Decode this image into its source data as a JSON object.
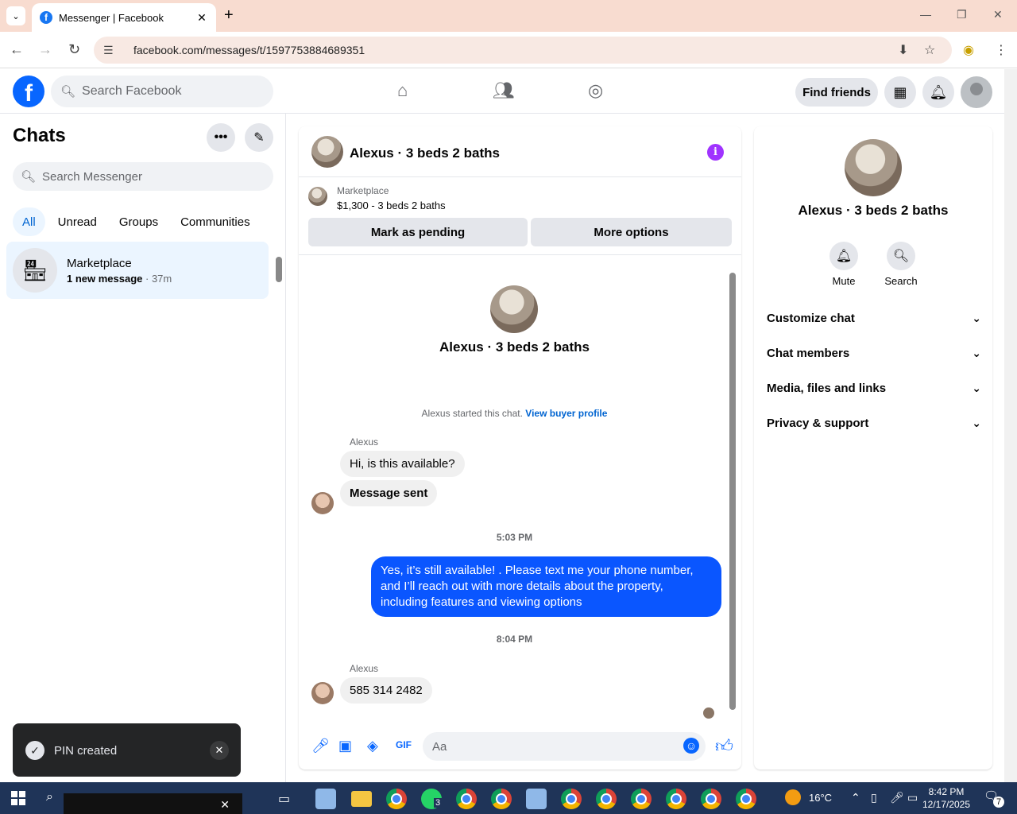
{
  "browser": {
    "tab_title": "Messenger | Facebook",
    "url": "facebook.com/messages/t/1597753884689351"
  },
  "header": {
    "search_placeholder": "Search Facebook",
    "find_friends": "Find friends"
  },
  "left": {
    "title": "Chats",
    "search_placeholder": "Search Messenger",
    "filters": [
      "All",
      "Unread",
      "Groups",
      "Communities"
    ],
    "chat": {
      "name": "Marketplace",
      "subtitle_bold": "1 new message",
      "time": "37m"
    }
  },
  "conversation": {
    "title": "Alexus · 3 beds 2 baths",
    "listing_source": "Marketplace",
    "listing_price": "$1,300 - 3 beds 2 baths",
    "mark_pending": "Mark as pending",
    "more_options": "More options",
    "profile_name": "Alexus · 3 beds 2 baths",
    "started_text": "Alexus started this chat.",
    "view_buyer": "View buyer profile",
    "sender1": "Alexus",
    "msg1": "Hi, is this available?",
    "msg2": "Message sent",
    "time1": "5:03 PM",
    "reply": "Yes, it’s still available! . Please text me your phone number, and I’ll reach out with more details about the property, including features and viewing options",
    "time2": "8:04 PM",
    "sender2": "Alexus",
    "msg3": "585 314 2482",
    "composer_placeholder": "Aa"
  },
  "right": {
    "name": "Alexus · 3 beds 2 baths",
    "mute": "Mute",
    "search": "Search",
    "sections": [
      "Customize chat",
      "Chat members",
      "Media, files and links",
      "Privacy & support"
    ]
  },
  "toast": {
    "text": "PIN created"
  },
  "taskbar": {
    "whatsapp_count": "3",
    "temperature": "16°C",
    "time": "8:42 PM",
    "date": "12/17/2025",
    "notifications": "7"
  },
  "colors": {
    "accent": "#0866ff",
    "outgoing_bubble": "#0a56ff",
    "info_icon": "#a033ff"
  }
}
